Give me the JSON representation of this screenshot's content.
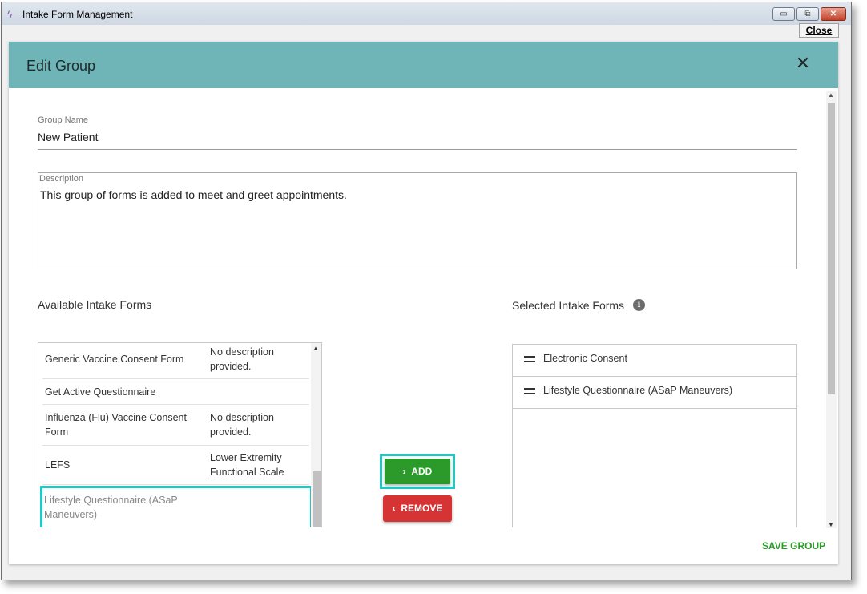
{
  "window": {
    "title": "Intake Form Management",
    "close_label": "Close",
    "controls": {
      "minimize": "▭",
      "restore": "⧉",
      "close": "✕"
    }
  },
  "dialog": {
    "title": "Edit Group",
    "close_icon": "✕",
    "group_name": {
      "label": "Group Name",
      "value": "New Patient"
    },
    "description": {
      "label": "Description",
      "value": "This group of forms is added to meet and greet appointments."
    },
    "available_label": "Available Intake Forms",
    "selected_label": "Selected Intake Forms",
    "available_forms": [
      {
        "name": "Generic Vaccine Consent Form",
        "description": "No description provided."
      },
      {
        "name": "Get Active Questionnaire",
        "description": ""
      },
      {
        "name": "Influenza (Flu) Vaccine Consent Form",
        "description": "No description provided."
      },
      {
        "name": "LEFS",
        "description": "Lower Extremity Functional Scale"
      },
      {
        "name": "Lifestyle Questionnaire (ASaP Maneuvers)",
        "description": ""
      }
    ],
    "selected_forms": [
      {
        "name": "Electronic Consent"
      },
      {
        "name": "Lifestyle Questionnaire (ASaP Maneuvers)"
      }
    ],
    "add_label": "ADD",
    "add_icon": "›",
    "remove_label": "REMOVE",
    "remove_icon": "‹",
    "save_label": "SAVE GROUP",
    "info_icon": "i",
    "colors": {
      "header": "#6fb4b6",
      "add": "#2b9a2b",
      "remove": "#d63434",
      "highlight": "#1ec9c3"
    }
  }
}
